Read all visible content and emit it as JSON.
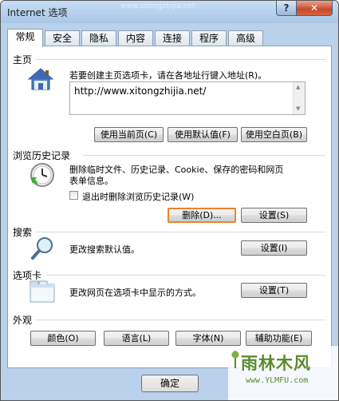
{
  "window": {
    "title": "Internet 选项",
    "title_watermark": "www.xitongzhijia.net",
    "help_label": "?",
    "close_label": "✕"
  },
  "tabs": [
    {
      "label": "常规",
      "active": true
    },
    {
      "label": "安全"
    },
    {
      "label": "隐私"
    },
    {
      "label": "内容"
    },
    {
      "label": "连接"
    },
    {
      "label": "程序"
    },
    {
      "label": "高级"
    }
  ],
  "homepage": {
    "group_label": "主页",
    "description": "若要创建主页选项卡，请在各地址行键入地址(R)。",
    "url": "http://www.xitongzhijia.net/",
    "buttons": {
      "use_current": "使用当前页(C)",
      "use_default": "使用默认值(F)",
      "use_blank": "使用空白页(B)"
    }
  },
  "history": {
    "group_label": "浏览历史记录",
    "description_line1": "删除临时文件、历史记录、Cookie、保存的密码和网页",
    "description_line2": "表单信息。",
    "checkbox_label": "退出时删除浏览历史记录(W)",
    "delete_button": "删除(D)...",
    "settings_button": "设置(S)"
  },
  "search": {
    "group_label": "搜索",
    "description": "更改搜索默认值。",
    "settings_button": "设置(I)"
  },
  "tabs_section": {
    "group_label": "选项卡",
    "description": "更改网页在选项卡中显示的方式。",
    "settings_button": "设置(T)"
  },
  "appearance": {
    "group_label": "外观",
    "buttons": {
      "colors": "颜色(O)",
      "languages": "语言(L)",
      "fonts": "字体(N)",
      "accessibility": "辅助功能(E)"
    }
  },
  "footer": {
    "ok": "确定"
  },
  "watermark_logo": {
    "name": "雨林木风",
    "url": "www.YLMFU.com"
  },
  "colors": {
    "highlight_border": "#e8852f",
    "close_button": "#c74a2c"
  }
}
